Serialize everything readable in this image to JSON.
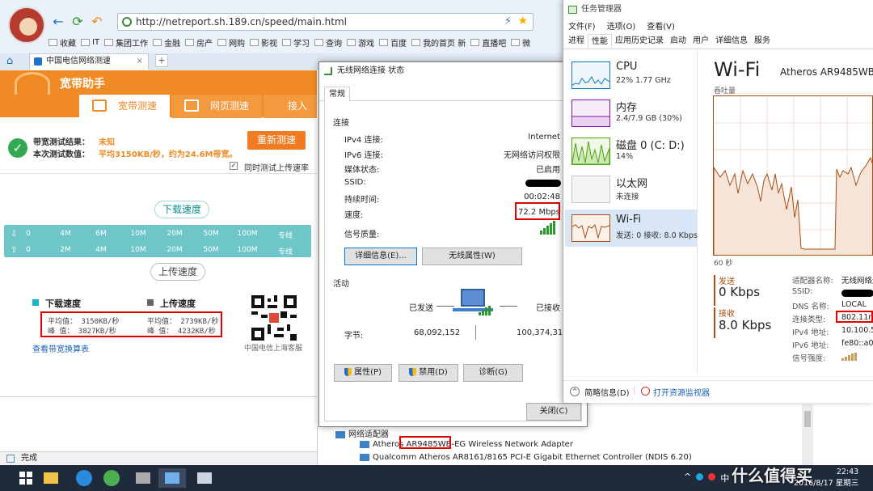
{
  "browser": {
    "url": "http://netreport.sh.189.cn/speed/main.html",
    "tab_title": "中国电信网络测速",
    "new_tab": "+",
    "bookmarks": [
      "收藏",
      "IT",
      "集团工作",
      "金融",
      "房产",
      "网购",
      "影视",
      "学习",
      "查询",
      "游戏",
      "百度",
      "我的首页 新",
      "直播吧",
      "微"
    ],
    "status": "完成"
  },
  "page": {
    "app_title": "宽带助手",
    "tabs": [
      "宽带测速",
      "网页测速",
      "接入"
    ],
    "result_label": "带宽测试结果：",
    "result_value": "未知",
    "current_label": "本次测试数值：",
    "current_value": "平均3150KB/秒，约为24.6M带宽。",
    "retest": "重新测速",
    "upload_check_label": "同时测试上传速率",
    "download_pill": "下载速度",
    "upload_pill": "上传速度",
    "download_ticks": [
      "0",
      "4M",
      "6M",
      "10M",
      "20M",
      "50M",
      "100M",
      "专线"
    ],
    "upload_ticks": [
      "0",
      "2M",
      "4M",
      "10M",
      "20M",
      "50M",
      "100M",
      "专线"
    ],
    "dl_title": "下载速度",
    "ul_title": "上传速度",
    "dl_avg": "平均值： 3150KB/秒",
    "dl_peak": "峰  值： 3827KB/秒",
    "ul_avg": "平均值： 2739KB/秒",
    "ul_peak": "峰  值： 4232KB/秒",
    "calc_link": "查看带宽换算表",
    "qr_caption": "中国电信上海客服"
  },
  "colors": {
    "orange": "#f08a24",
    "teal": "#6fc6c8",
    "tm_wifi": "#a74d11",
    "highlight": "#e00000"
  },
  "wifi_dialog": {
    "title": "无线网络连接 状态",
    "tab": "常规",
    "conn_section": "连接",
    "rows": [
      {
        "k": "IPv4 连接:",
        "v": "Internet"
      },
      {
        "k": "IPv6 连接:",
        "v": "无网络访问权限"
      },
      {
        "k": "媒体状态:",
        "v": "已启用"
      },
      {
        "k": "SSID:",
        "v": ""
      },
      {
        "k": "持续时间:",
        "v": "00:02:48"
      },
      {
        "k": "速度:",
        "v": "72.2 Mbps"
      }
    ],
    "signal_label": "信号质量:",
    "details_btn": "详细信息(E)...",
    "wireless_props_btn": "无线属性(W)",
    "activity_section": "活动",
    "sent_label": "已发送",
    "recv_label": "已接收",
    "bytes_label": "字节:",
    "bytes_sent": "68,092,152",
    "bytes_recv": "100,374,318",
    "props_btn": "属性(P)",
    "disable_btn": "禁用(D)",
    "diagnose_btn": "诊断(G)",
    "close_btn": "关闭(C)"
  },
  "device_manager": {
    "category": "网络适配器",
    "adapter1": "Atheros AR9485WB-EG Wireless Network Adapter",
    "adapter2": "Qualcomm Atheros AR8161/8165 PCI-E Gigabit Ethernet Controller (NDIS 6.20)"
  },
  "task_manager": {
    "title": "任务管理器",
    "menu": [
      "文件(F)",
      "选项(O)",
      "查看(V)"
    ],
    "tabs": [
      "进程",
      "性能",
      "应用历史记录",
      "启动",
      "用户",
      "详细信息",
      "服务"
    ],
    "resources": [
      {
        "name": "CPU",
        "sub": "22%  1.77 GHz"
      },
      {
        "name": "内存",
        "sub": "2.4/7.9 GB (30%)"
      },
      {
        "name": "磁盘 0 (C: D:)",
        "sub": "14%"
      },
      {
        "name": "以太网",
        "sub": "未连接"
      },
      {
        "name": "Wi-Fi",
        "sub": "发送: 0 接收: 8.0 Kbps"
      }
    ],
    "heading": "Wi-Fi",
    "adapter": "Atheros AR9485WB",
    "throughput": "吞吐量",
    "seconds": "60 秒",
    "send_label": "发送",
    "send_value": "0 Kbps",
    "recv_label": "接收",
    "recv_value": "8.0 Kbps",
    "details": [
      {
        "k": "适配器名称:",
        "v": "无线网络连"
      },
      {
        "k": "SSID:",
        "v": ""
      },
      {
        "k": "DNS 名称:",
        "v": "LOCAL"
      },
      {
        "k": "连接类型:",
        "v": "802.11n"
      },
      {
        "k": "IPv4 地址:",
        "v": "10.100.50"
      },
      {
        "k": "IPv6 地址:",
        "v": "fe80::a0a"
      },
      {
        "k": "信号强度:",
        "v": ""
      }
    ],
    "brief": "简略信息(D)",
    "resmon": "打开资源监视器"
  },
  "taskbar": {
    "time": "22:43",
    "date": "2016/8/17 星期三",
    "watermark": "什么值得买",
    "ime": "中"
  }
}
